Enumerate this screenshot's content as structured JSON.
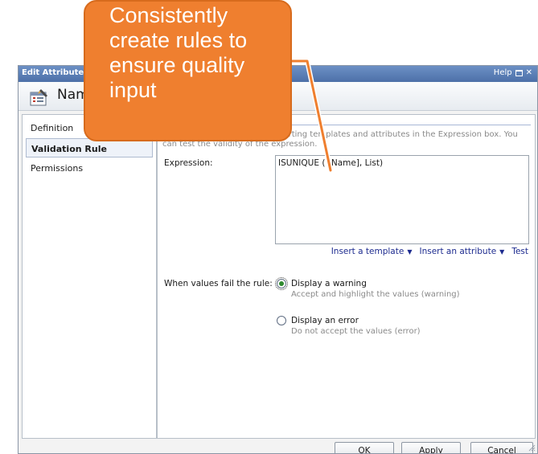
{
  "window": {
    "title": "Edit Attribute",
    "help_label": "Help"
  },
  "header": {
    "title": "Name"
  },
  "nav": {
    "items": [
      {
        "label": "Definition"
      },
      {
        "label": "Validation Rule"
      },
      {
        "label": "Permissions"
      }
    ],
    "selected": "Validation Rule"
  },
  "main": {
    "instructions": "Create a validation rule by inserting templates and attributes in the Expression box. You can test the validity of the expression.",
    "expression_label": "Expression:",
    "expression_value": "ISUNIQUE ( [Name], List)",
    "links": {
      "insert_template": "Insert a template",
      "insert_attribute": "Insert an attribute",
      "test": "Test"
    },
    "fail_label": "When values fail the rule:",
    "options": [
      {
        "label": "Display a warning",
        "description": "Accept and highlight the values (warning)",
        "selected": true
      },
      {
        "label": "Display an error",
        "description": "Do not accept the values (error)",
        "selected": false
      }
    ]
  },
  "buttons": {
    "ok": "OK",
    "apply": "Apply",
    "cancel": "Cancel"
  },
  "callout": {
    "lines": [
      "Consistently",
      "create rules to",
      "ensure quality",
      "input"
    ]
  },
  "colors": {
    "title_bar": "#5a7db5",
    "callout": "#ef7f2f",
    "link": "#1d2b8f",
    "radio_selected": "#2f8a2f"
  },
  "icons": {
    "header": "attribute-edit-icon",
    "maximize": "maximize-icon",
    "close": "close-icon",
    "caret": "caret-down-icon"
  }
}
